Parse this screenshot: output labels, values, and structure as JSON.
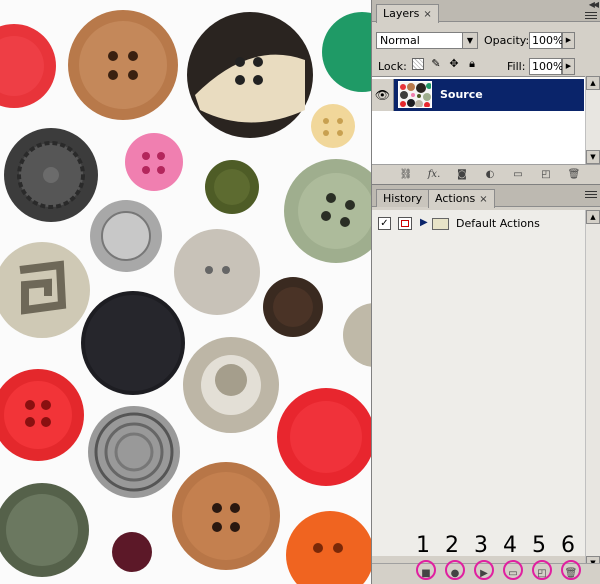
{
  "layers_panel": {
    "tab_label": "Layers",
    "tab_close": "×",
    "blend_mode": "Normal",
    "opacity_label": "Opacity:",
    "opacity_value": "100%",
    "lock_label": "Lock:",
    "fill_label": "Fill:",
    "fill_value": "100%",
    "layers": [
      {
        "name": "Source",
        "visible": true,
        "selected": true
      }
    ],
    "bottom_icons": [
      "link-icon",
      "fx-icon",
      "mask-icon",
      "adjustment-icon",
      "folder-icon",
      "new-layer-icon",
      "trash-icon"
    ],
    "bottom_fx_label": "fx."
  },
  "actions_panel": {
    "tabs": [
      {
        "label": "History",
        "active": false
      },
      {
        "label": "Actions",
        "active": true
      }
    ],
    "tab_close": "×",
    "actions": [
      {
        "name": "Default Actions",
        "checked": true,
        "expanded": false
      }
    ],
    "bottom_icons": [
      "stop-icon",
      "record-icon",
      "play-icon",
      "folder-icon",
      "new-action-icon",
      "trash-icon"
    ]
  },
  "callouts": [
    "1",
    "2",
    "3",
    "4",
    "5",
    "6"
  ],
  "colors": {
    "panel_bg": "#d4d0c8",
    "selection": "#0a246a",
    "callout": "#e020a0"
  }
}
